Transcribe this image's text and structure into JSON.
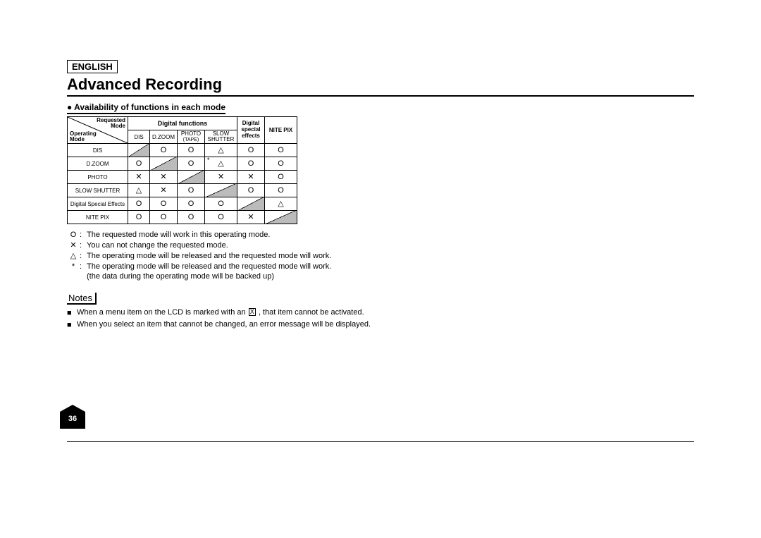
{
  "language": "ENGLISH",
  "title": "Advanced Recording",
  "subtitle_bullet": "●",
  "subtitle": "Availability of functions in each mode",
  "table": {
    "corner": {
      "tr1": "Requested",
      "tr2": "Mode",
      "bl1": "Operating",
      "bl2": "Mode"
    },
    "group_digital": "Digital functions",
    "cols": [
      "DIS",
      "D.ZOOM",
      "PHOTO",
      "SLOW",
      "Digital",
      "NITE PIX"
    ],
    "col_sub": {
      "photo": "(TAPE)",
      "slow": "SHUTTER",
      "dse1": "special",
      "dse2": "effects"
    },
    "rows": [
      {
        "label": "DIS",
        "cells": [
          "DIAG",
          "O",
          "O",
          "TRI",
          "O",
          "O"
        ]
      },
      {
        "label": "D.ZOOM",
        "cells": [
          "O",
          "DIAG",
          "O",
          "STAR_TRI",
          "O",
          "O"
        ]
      },
      {
        "label": "PHOTO",
        "cells": [
          "X",
          "X",
          "DIAG",
          "X",
          "X",
          "O"
        ]
      },
      {
        "label": "SLOW SHUTTER",
        "cells": [
          "TRI",
          "X",
          "O",
          "DIAG",
          "O",
          "O"
        ]
      },
      {
        "label": "Digital Special Effects",
        "cells": [
          "O",
          "O",
          "O",
          "O",
          "DIAG",
          "TRI"
        ]
      },
      {
        "label": "NITE PIX",
        "cells": [
          "O",
          "O",
          "O",
          "O",
          "X",
          "DIAG"
        ]
      }
    ]
  },
  "symbols": {
    "O": "O",
    "X": "✕",
    "TRI": "△"
  },
  "legend": {
    "o": "The requested mode will work in this operating mode.",
    "x": "You can not change the requested mode.",
    "tri": "The operating mode will be released and the requested mode will work.",
    "star": "The operating mode will be released and the requested mode will work.",
    "indent": "(the data during the operating mode will be backed up)"
  },
  "notes_label": "Notes",
  "notes": {
    "n1a": "When a menu item on the LCD is marked with an",
    "n1b": ", that item cannot be activated.",
    "n1_box": "X",
    "n2": "When you select an item that cannot be changed, an error message will be displayed."
  },
  "page_number": "36"
}
